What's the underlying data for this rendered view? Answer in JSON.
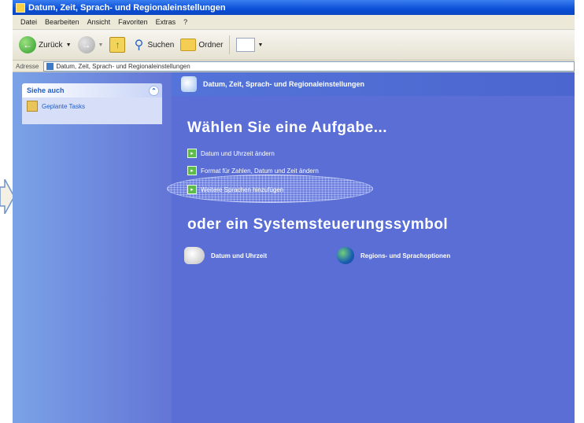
{
  "window": {
    "title": "Datum, Zeit, Sprach- und Regionaleinstellungen",
    "title_prefix": "Datum, Zeit,"
  },
  "menu": {
    "items": [
      "Datei",
      "Bearbeiten",
      "Ansicht",
      "Favoriten",
      "Extras",
      "?"
    ]
  },
  "toolbar": {
    "back_label": "Zurück",
    "search_label": "Suchen",
    "folders_label": "Ordner"
  },
  "address": {
    "label": "Adresse",
    "value": "Datum, Zeit, Sprach- und Regionaleinstellungen"
  },
  "sidebar": {
    "see_also_title": "Siehe auch",
    "items": [
      {
        "label": "Geplante Tasks"
      }
    ]
  },
  "main": {
    "header_title": "Datum, Zeit, Sprach- und Regionaleinstellungen",
    "task_heading": "Wählen Sie eine Aufgabe...",
    "tasks": [
      {
        "label": "Datum und Uhrzeit ändern"
      },
      {
        "label": "Format für Zahlen, Datum und Zeit ändern"
      },
      {
        "label": "Weitere Sprachen hinzufügen"
      }
    ],
    "or_heading": "oder ein Systemsteuerungssymbol",
    "control_panel_items": [
      {
        "label": "Datum und Uhrzeit",
        "icon": "clock-icon"
      },
      {
        "label": "Regions- und Sprachoptionen",
        "icon": "globe-icon"
      }
    ]
  },
  "colors": {
    "main_bg": "#5a6ed6",
    "sidebar_bg": "#7ba2e7",
    "titlebar": "#0b4fd6"
  }
}
